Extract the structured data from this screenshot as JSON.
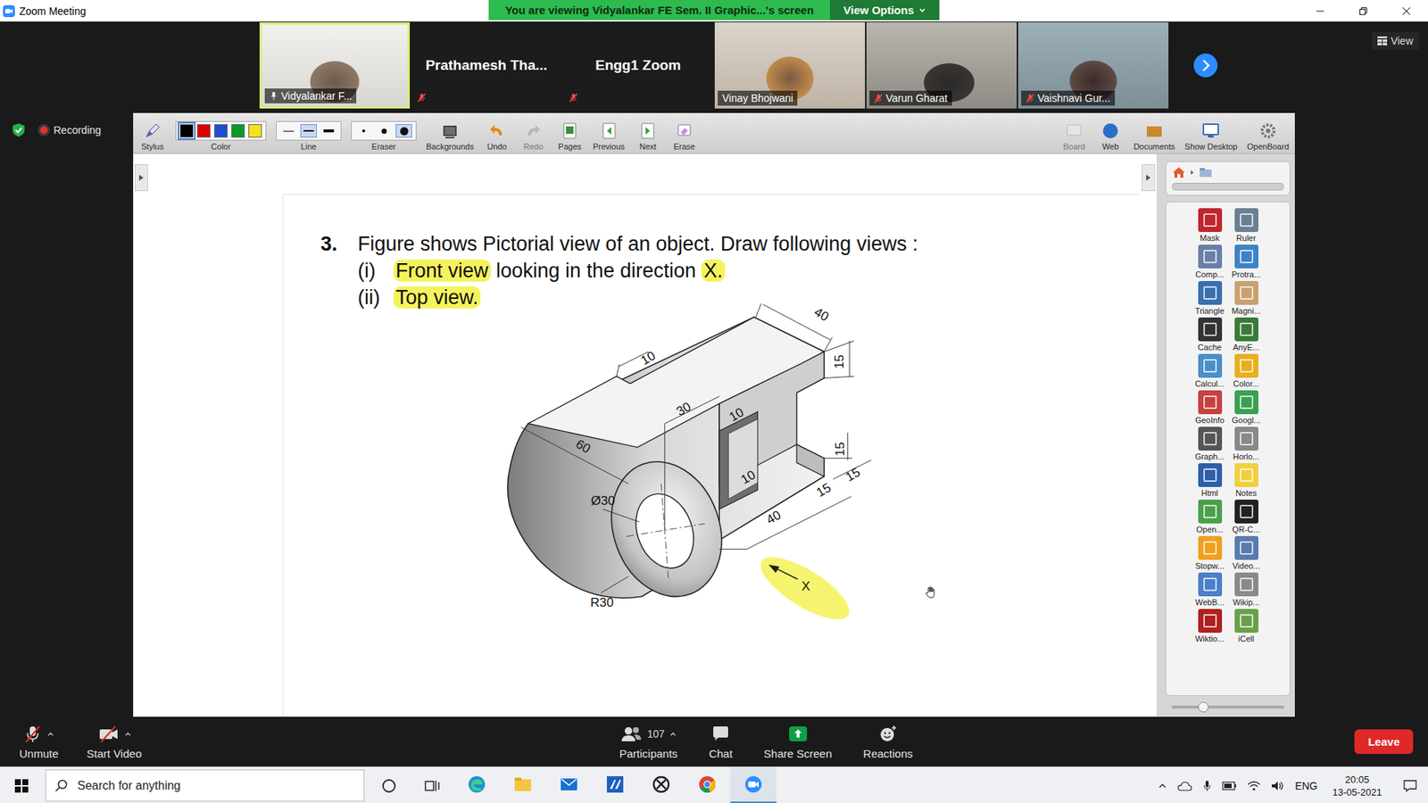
{
  "window": {
    "title": "Zoom Meeting"
  },
  "share_banner": {
    "text": "You are viewing Vidyalankar FE Sem. II Graphic...'s screen",
    "view_options": "View Options"
  },
  "gallery": {
    "tiles": [
      {
        "name": "Vidyalankar F...",
        "kind": "video",
        "muted": false,
        "pinned": true,
        "active_speaker": true
      },
      {
        "name": "Prathamesh  Tha...",
        "kind": "name",
        "muted": true,
        "pinned": false,
        "active_speaker": false
      },
      {
        "name": "Engg1 Zoom",
        "kind": "name",
        "muted": true,
        "pinned": false,
        "active_speaker": false
      },
      {
        "name": "Vinay Bhojwani",
        "kind": "video",
        "muted": false,
        "pinned": false,
        "active_speaker": false
      },
      {
        "name": "Varun Gharat",
        "kind": "video",
        "muted": true,
        "pinned": false,
        "active_speaker": false
      },
      {
        "name": "Vaishnavi Gur...",
        "kind": "video",
        "muted": true,
        "pinned": false,
        "active_speaker": false
      }
    ],
    "view_button": "View"
  },
  "recording": {
    "label": "Recording",
    "on": true
  },
  "board_toolbar": {
    "left": [
      {
        "label": "Stylus",
        "kind": "button",
        "disabled": false
      },
      {
        "label": "Color",
        "kind": "colors",
        "options": [
          {
            "color": "#000000",
            "selected": true
          },
          {
            "color": "#e00000",
            "selected": false
          },
          {
            "color": "#1f4fd0",
            "selected": false
          },
          {
            "color": "#0a9a2a",
            "selected": false
          },
          {
            "color": "#f2e21a",
            "selected": false
          }
        ]
      },
      {
        "label": "Line",
        "kind": "widths",
        "options": [
          {
            "selected": false
          },
          {
            "selected": true
          },
          {
            "selected": false
          }
        ]
      },
      {
        "label": "Eraser",
        "kind": "sizes",
        "options": [
          {
            "selected": false
          },
          {
            "selected": false
          },
          {
            "selected": true
          }
        ]
      },
      {
        "label": "Backgrounds",
        "kind": "button",
        "disabled": false
      },
      {
        "label": "Undo",
        "kind": "button",
        "disabled": false
      },
      {
        "label": "Redo",
        "kind": "button",
        "disabled": true
      },
      {
        "label": "Pages",
        "kind": "button",
        "disabled": false
      },
      {
        "label": "Previous",
        "kind": "button",
        "disabled": false
      },
      {
        "label": "Next",
        "kind": "button",
        "disabled": false
      },
      {
        "label": "Erase",
        "kind": "button",
        "disabled": false
      }
    ],
    "right": [
      {
        "label": "Board",
        "disabled": true
      },
      {
        "label": "Web",
        "disabled": false
      },
      {
        "label": "Documents",
        "disabled": false
      },
      {
        "label": "Show Desktop",
        "disabled": false
      },
      {
        "label": "OpenBoard",
        "disabled": false
      }
    ]
  },
  "question": {
    "number": "3.",
    "text": "Figure shows Pictorial view of an object. Draw following views :",
    "items": [
      {
        "marker": "(i)",
        "segments": [
          {
            "text": "Front view",
            "highlight": true
          },
          {
            "text": " looking in the direction ",
            "highlight": false
          },
          {
            "text": "X.",
            "highlight": true
          }
        ]
      },
      {
        "marker": "(ii)",
        "segments": [
          {
            "text": "Top view.",
            "highlight": true
          }
        ]
      }
    ]
  },
  "figure": {
    "dimensions": [
      {
        "text": "40"
      },
      {
        "text": "15"
      },
      {
        "text": "10"
      },
      {
        "text": "30"
      },
      {
        "text": "10"
      },
      {
        "text": "60"
      },
      {
        "text": "Ø30"
      },
      {
        "text": "15"
      },
      {
        "text": "15"
      },
      {
        "text": "10"
      },
      {
        "text": "15"
      },
      {
        "text": "40"
      },
      {
        "text": "R30"
      }
    ],
    "arrow_label": "X"
  },
  "board_sidebar": {
    "tools": [
      "Mask",
      "Ruler",
      "Comp...",
      "Protra...",
      "Triangle",
      "Magni...",
      "Cache",
      "AnyE...",
      "Calcul...",
      "Color...",
      "GeoInfo",
      "Googl...",
      "Graph...",
      "Horlo...",
      "Html",
      "Notes",
      "Open...",
      "QR-C...",
      "Stopw...",
      "Video...",
      "WebB...",
      "Wikip...",
      "Wiktio...",
      "iCell"
    ],
    "zoom_level": 0.28
  },
  "meeting_controls": {
    "unmute": "Unmute",
    "start_video": "Start Video",
    "participants": {
      "label": "Participants",
      "count": "107"
    },
    "chat": "Chat",
    "share_screen": "Share Screen",
    "reactions": "Reactions",
    "leave": "Leave"
  },
  "taskbar": {
    "search_placeholder": "Search for anything",
    "apps": [
      {
        "active": false
      },
      {
        "active": false
      },
      {
        "active": false
      },
      {
        "active": false
      },
      {
        "active": false
      },
      {
        "active": false
      },
      {
        "active": true
      }
    ],
    "language": "ENG",
    "time": "20:05",
    "date": "13-05-2021"
  }
}
